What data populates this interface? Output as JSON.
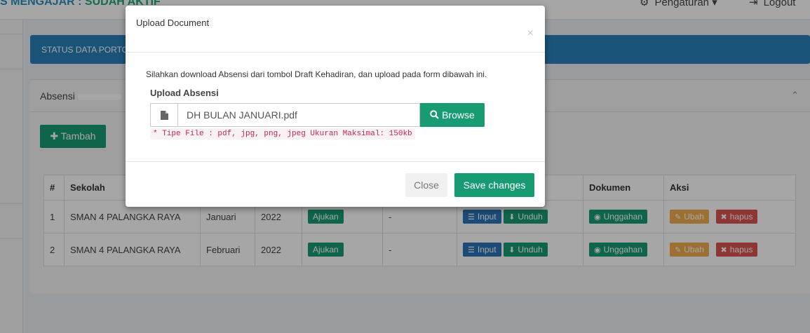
{
  "navbar": {
    "status_prefix": "S MENGAJAR : ",
    "status_value": "SUDAH AKTIF",
    "settings_label": "Pengaturan",
    "settings_caret": "▾",
    "logout_label": "Logout"
  },
  "status_box": {
    "text": "STATUS DATA PORTO"
  },
  "panel": {
    "title": "Absensi",
    "collapse_glyph": "⌃",
    "add_button": "Tambah",
    "add_glyph": "✚"
  },
  "table": {
    "headers": [
      "#",
      "Sekolah",
      "",
      "",
      "",
      "",
      "",
      "Dokumen",
      "Aksi"
    ],
    "rows": [
      {
        "no": "1",
        "sekolah": "SMAN 4 PALANGKA RAYA",
        "bulan": "Januari",
        "tahun": "2022",
        "status": "Ajukan",
        "ket": "-",
        "input": "Input",
        "unduh": "Unduh",
        "unggahan": "Unggahan",
        "ubah": "Ubah",
        "hapus": "hapus"
      },
      {
        "no": "2",
        "sekolah": "SMAN 4 PALANGKA RAYA",
        "bulan": "Februari",
        "tahun": "2022",
        "status": "Ajukan",
        "ket": "-",
        "input": "Input",
        "unduh": "Unduh",
        "unggahan": "Unggahan",
        "ubah": "Ubah",
        "hapus": "hapus"
      }
    ]
  },
  "modal": {
    "title": "Upload Document",
    "close_glyph": "×",
    "message": "Silahkan download Absensi dari tombol Draft Kehadiran, dan upload pada form dibawah ini.",
    "upload_label": "Upload Absensi",
    "file_value": "DH BULAN JANUARI.pdf",
    "browse_label": "Browse",
    "file_hint": "* Tipe File : pdf, jpg, png, jpeg Ukuran Maksimal: 150kb",
    "close_button": "Close",
    "save_button": "Save changes"
  },
  "icons": {
    "settings": "gear-icon",
    "logout": "logout-icon",
    "file": "file-icon",
    "search": "search-icon",
    "list": "list-icon",
    "download": "download-icon",
    "eye": "eye-icon",
    "edit": "edit-icon",
    "delete": "times-icon"
  },
  "colors": {
    "primary_green": "#169b73",
    "primary_blue": "#2a80b9",
    "warning": "#f0ad4e",
    "danger": "#d9534f"
  }
}
